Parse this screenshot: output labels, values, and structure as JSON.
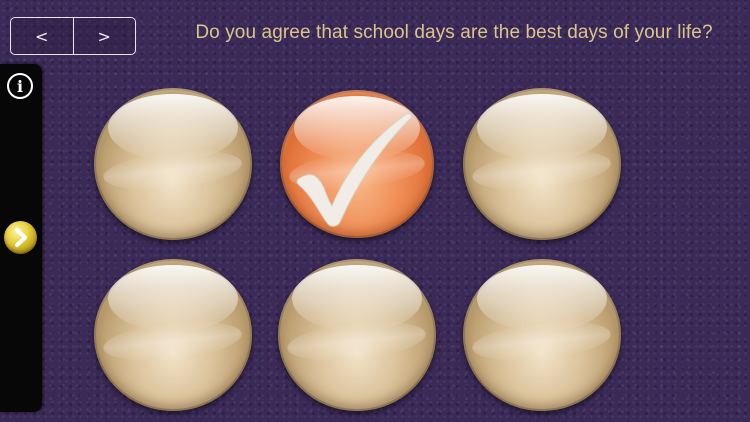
{
  "nav": {
    "prev_label": "<",
    "next_label": ">"
  },
  "question": {
    "text": "Do you agree that school days are the best days of your life?"
  },
  "side_panel": {
    "info_label": "i",
    "expand_icon": "chevron-right-icon"
  },
  "answers": {
    "orb1": {
      "color": "gold",
      "selected": false
    },
    "orb2": {
      "color": "orange",
      "selected": true
    },
    "orb3": {
      "color": "gold",
      "selected": false
    },
    "orb4": {
      "color": "gold",
      "selected": false
    },
    "orb5": {
      "color": "gold",
      "selected": false
    },
    "orb6": {
      "color": "gold",
      "selected": false
    }
  },
  "colors": {
    "background": "#3b2a58",
    "question_text": "#dcc58c",
    "orb_gold": "#dcc49d",
    "orb_selected": "#ef8d55",
    "expand_button": "#e7cf3d"
  }
}
